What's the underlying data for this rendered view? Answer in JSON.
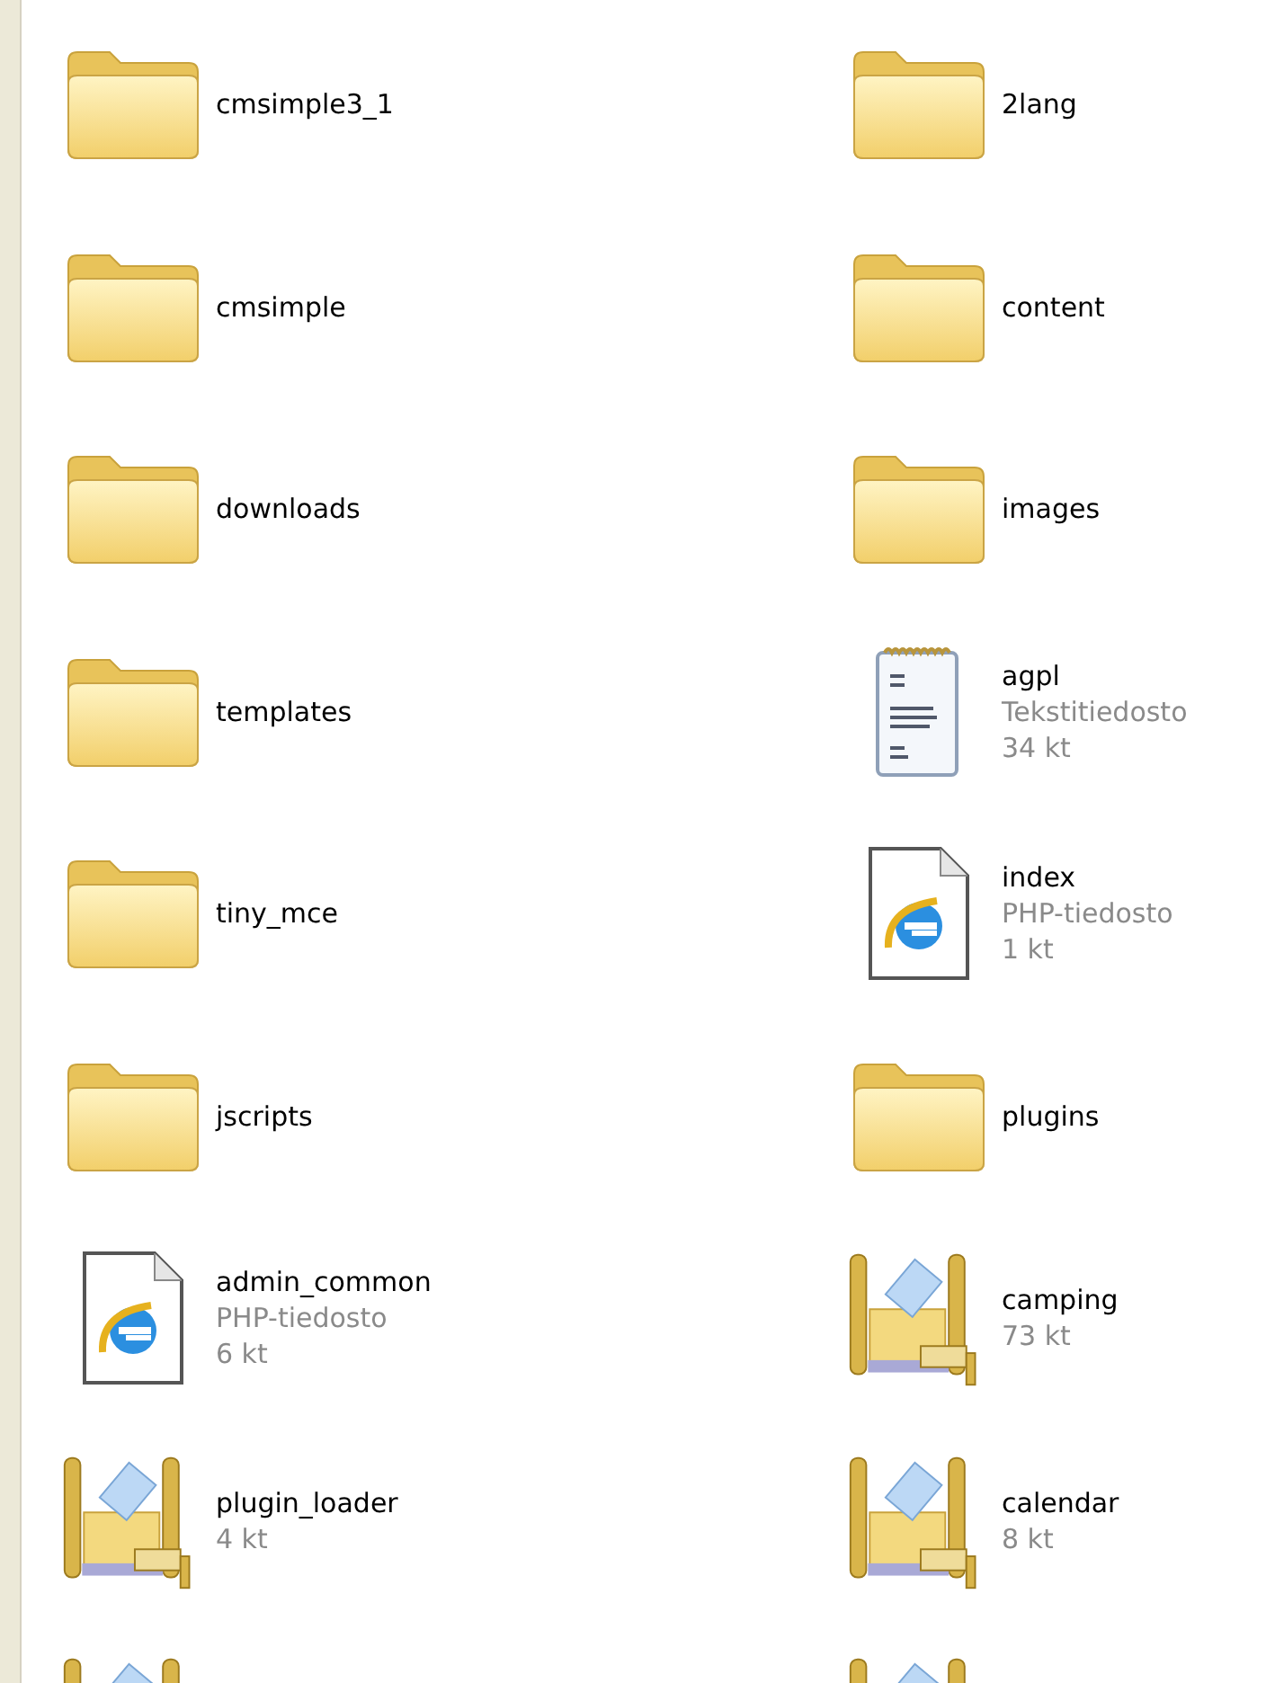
{
  "rows": [
    {
      "tiles": [
        {
          "kind": "folder",
          "name": "cmsimple3_1"
        },
        {
          "kind": "folder",
          "name": "2lang"
        }
      ]
    },
    {
      "tiles": [
        {
          "kind": "folder",
          "name": "cmsimple"
        },
        {
          "kind": "folder",
          "name": "content"
        }
      ]
    },
    {
      "tiles": [
        {
          "kind": "folder",
          "name": "downloads"
        },
        {
          "kind": "folder",
          "name": "images"
        }
      ]
    },
    {
      "tiles": [
        {
          "kind": "folder",
          "name": "templates"
        },
        {
          "kind": "text",
          "name": "agpl",
          "type": "Tekstitiedosto",
          "size": "34 kt"
        }
      ]
    },
    {
      "tiles": [
        {
          "kind": "folder",
          "name": "tiny_mce"
        },
        {
          "kind": "php",
          "name": "index",
          "type": "PHP-tiedosto",
          "size": "1 kt"
        }
      ]
    },
    {
      "tiles": [
        {
          "kind": "folder",
          "name": "jscripts"
        },
        {
          "kind": "folder",
          "name": "plugins"
        }
      ]
    },
    {
      "tiles": [
        {
          "kind": "php",
          "name": "admin_common",
          "type": "PHP-tiedosto",
          "size": "6 kt"
        },
        {
          "kind": "zip",
          "name": "camping",
          "size": "73 kt"
        }
      ]
    },
    {
      "tiles": [
        {
          "kind": "zip",
          "name": "plugin_loader",
          "size": "4 kt"
        },
        {
          "kind": "zip",
          "name": "calendar",
          "size": "8 kt"
        }
      ]
    },
    {
      "tiles": [
        {
          "kind": "zip"
        },
        {
          "kind": "zip"
        }
      ]
    }
  ]
}
